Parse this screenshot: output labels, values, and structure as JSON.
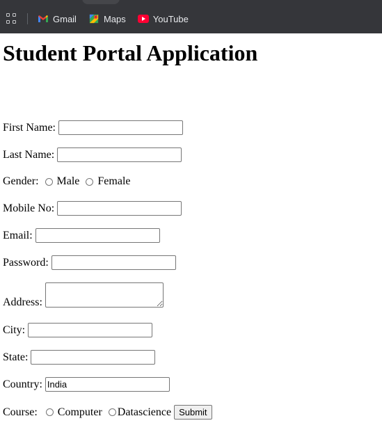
{
  "bookmarks": [
    {
      "label": "Gmail",
      "icon": "gmail-icon"
    },
    {
      "label": "Maps",
      "icon": "maps-icon"
    },
    {
      "label": "YouTube",
      "icon": "youtube-icon"
    }
  ],
  "colors": {
    "chrome_bar": "#35363a",
    "youtube_red": "#ff0000"
  },
  "page": {
    "title": "Student Portal Application",
    "fields": {
      "first_name": {
        "label": "First Name:",
        "value": ""
      },
      "last_name": {
        "label": "Last Name:",
        "value": ""
      },
      "gender": {
        "label": "Gender:",
        "options": [
          "Male",
          "Female"
        ]
      },
      "mobile": {
        "label": "Mobile No:",
        "value": ""
      },
      "email": {
        "label": "Email:",
        "value": ""
      },
      "password": {
        "label": "Password:",
        "value": ""
      },
      "address": {
        "label": "Address:",
        "value": ""
      },
      "city": {
        "label": "City:",
        "value": ""
      },
      "state": {
        "label": "State:",
        "value": ""
      },
      "country": {
        "label": "Country:",
        "value": "India"
      },
      "course": {
        "label": "Course:",
        "options": [
          "Computer",
          "Datascience"
        ]
      }
    },
    "submit_label": "Submit"
  }
}
